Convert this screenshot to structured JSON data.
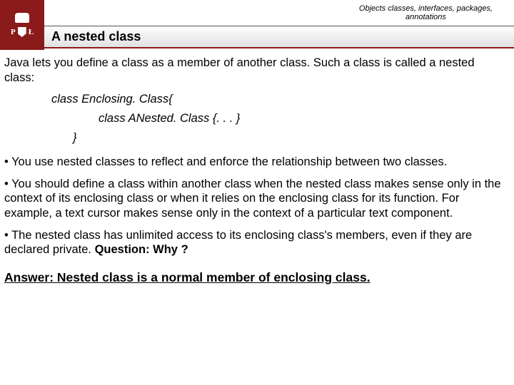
{
  "header": {
    "topic_line1": "Objects classes, interfaces, packages,",
    "topic_line2": "annotations",
    "logo_left": "P",
    "logo_right": "Ł",
    "title": "A nested class"
  },
  "body": {
    "intro": "Java lets you define a class as a member of another class. Such a class is called a nested class:",
    "code1": "class Enclosing. Class{",
    "code2": "class ANested. Class {. . . }",
    "code3": "}",
    "bullet1": "• You use nested classes to reflect and enforce the relationship between two classes.",
    "bullet2": "• You should define a class within another class when the nested class makes sense only in the context of its enclosing class or when it relies on the enclosing class for its function. For example, a text cursor makes sense only in the context of a particular text component.",
    "bullet3_a": "• The nested class has unlimited access to its enclosing class's members, even if they are declared private. ",
    "bullet3_b": "Question: Why ?",
    "answer": "Answer: Nested class is a normal member of enclosing class."
  }
}
